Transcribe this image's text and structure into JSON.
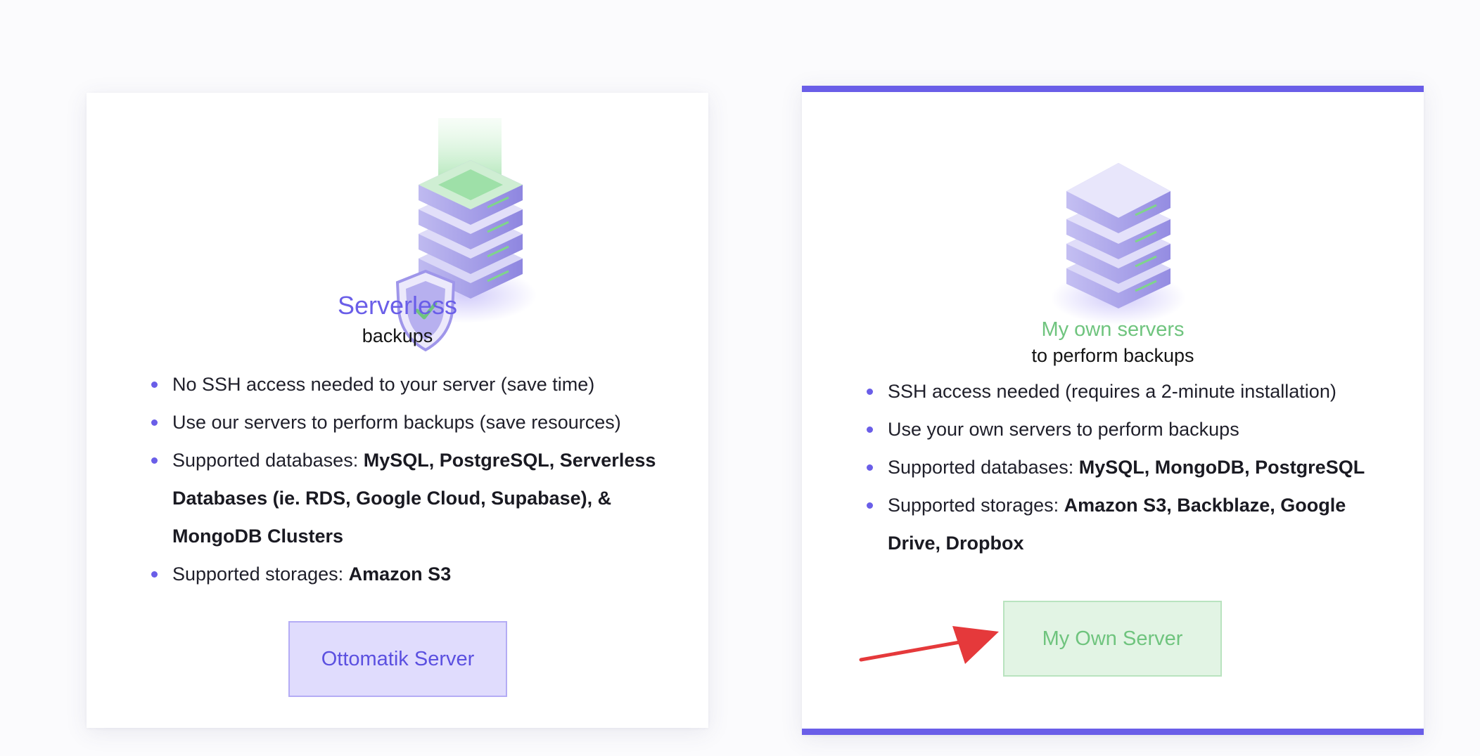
{
  "left_card": {
    "title": "Serverless",
    "subtitle": "backups",
    "features": [
      {
        "text": "No SSH access needed to your server (save time)",
        "bold": ""
      },
      {
        "text": "Use our servers to perform backups (save resources)",
        "bold": ""
      },
      {
        "text": "Supported databases: ",
        "bold": "MySQL, PostgreSQL, Serverless Databases (ie. RDS, Google Cloud, Supabase), & MongoDB Clusters"
      },
      {
        "text": "Supported storages: ",
        "bold": "Amazon S3"
      }
    ],
    "button_label": "Ottomatik Server"
  },
  "right_card": {
    "title": "My own servers",
    "subtitle": "to perform backups",
    "features": [
      {
        "text": "SSH access needed (requires a 2-minute installation)",
        "bold": ""
      },
      {
        "text": "Use your own servers to perform backups",
        "bold": ""
      },
      {
        "text": "Supported databases: ",
        "bold": "MySQL, MongoDB, PostgreSQL"
      },
      {
        "text": "Supported storages: ",
        "bold": "Amazon S3, Backblaze, Google Drive, Dropbox"
      }
    ],
    "button_label": "My Own Server"
  },
  "colors": {
    "accent_purple": "#6a5ee8",
    "accent_green": "#6fc47e",
    "annotation_arrow": "#e5393b"
  },
  "icons": [
    "server-stack-shield-icon",
    "server-stack-icon",
    "bullet-dot-icon",
    "annotation-arrow-icon"
  ]
}
